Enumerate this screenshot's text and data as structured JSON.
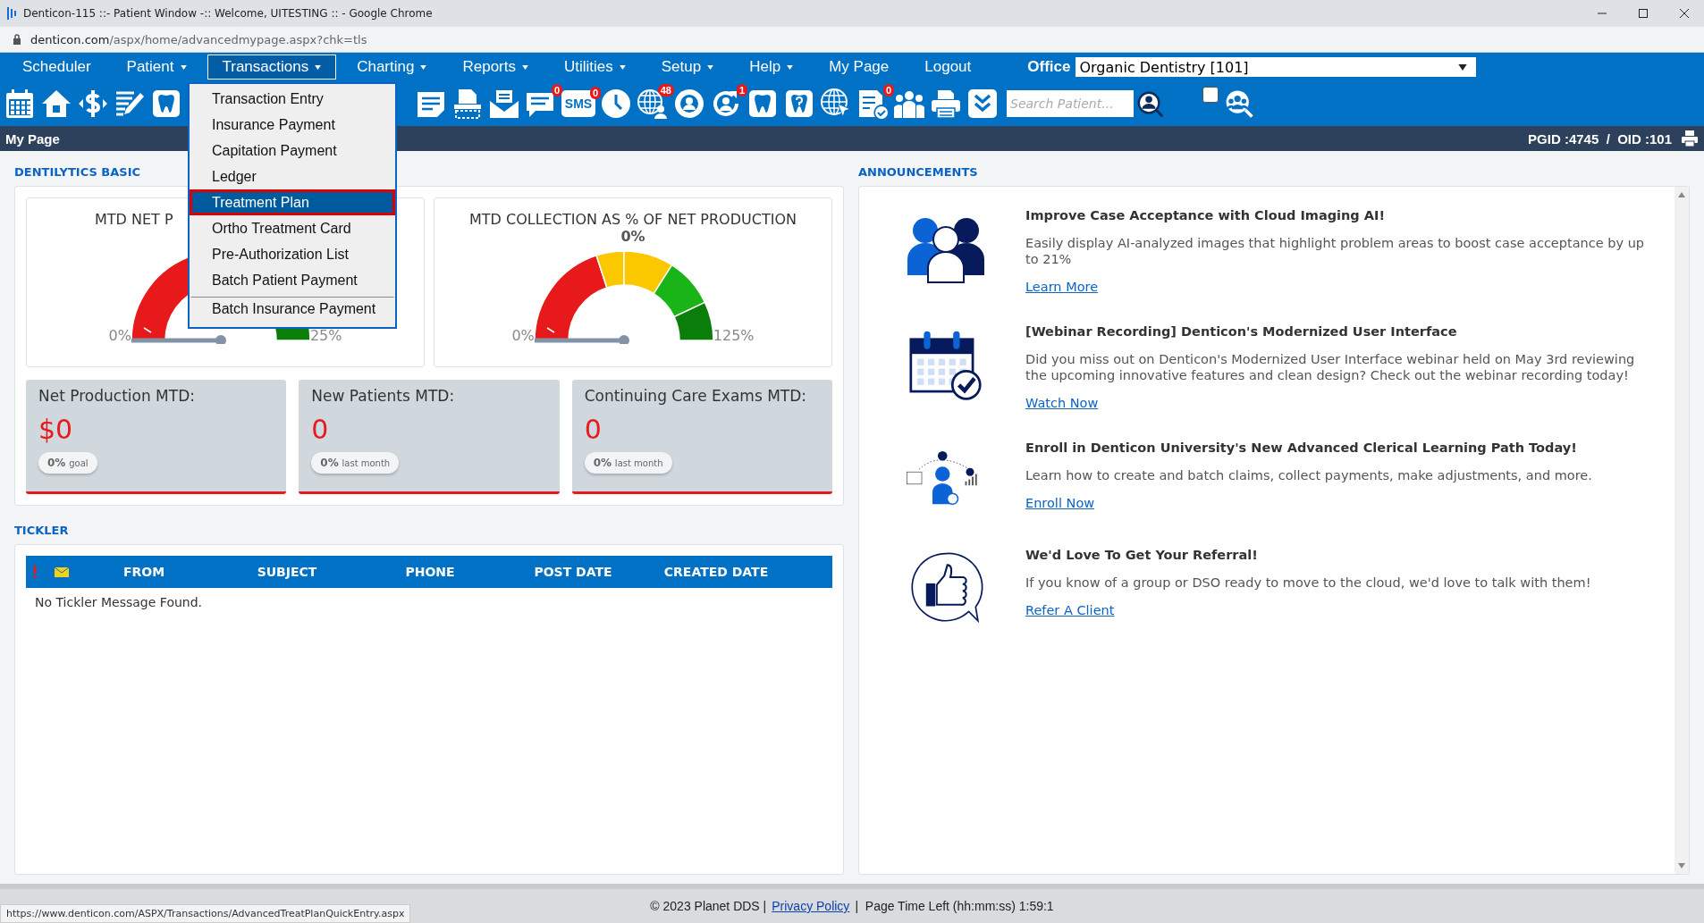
{
  "browser": {
    "title": "Denticon-115 ::- Patient Window -:: Welcome, UITESTING :: - Google Chrome",
    "url_domain": "denticon.com",
    "url_path": "/aspx/home/advancedmypage.aspx?chk=tls"
  },
  "menu": [
    {
      "label": "Scheduler",
      "dropdown": false,
      "selected": false
    },
    {
      "label": "Patient",
      "dropdown": true,
      "selected": false
    },
    {
      "label": "Transactions",
      "dropdown": true,
      "selected": true
    },
    {
      "label": "Charting",
      "dropdown": true,
      "selected": false
    },
    {
      "label": "Reports",
      "dropdown": true,
      "selected": false
    },
    {
      "label": "Utilities",
      "dropdown": true,
      "selected": false
    },
    {
      "label": "Setup",
      "dropdown": true,
      "selected": false
    },
    {
      "label": "Help",
      "dropdown": true,
      "selected": false
    },
    {
      "label": "My Page",
      "dropdown": false,
      "selected": false
    },
    {
      "label": "Logout",
      "dropdown": false,
      "selected": false
    }
  ],
  "office": {
    "label": "Office",
    "value": "Organic Dentistry [101]"
  },
  "dropdown_items": [
    {
      "label": "Transaction Entry",
      "selected": false,
      "separator_before": false
    },
    {
      "label": "Insurance Payment",
      "selected": false,
      "separator_before": false
    },
    {
      "label": "Capitation Payment",
      "selected": false,
      "separator_before": false
    },
    {
      "label": "Ledger",
      "selected": false,
      "separator_before": false
    },
    {
      "label": "Treatment Plan",
      "selected": true,
      "separator_before": false
    },
    {
      "label": "Ortho Treatment Card",
      "selected": false,
      "separator_before": false
    },
    {
      "label": "Pre-Authorization List",
      "selected": false,
      "separator_before": false
    },
    {
      "label": "Batch Patient Payment",
      "selected": false,
      "separator_before": false
    },
    {
      "label": "Batch Insurance Payment",
      "selected": false,
      "separator_before": true
    }
  ],
  "toolbar": {
    "badges": [
      "0",
      "0",
      "48",
      "1",
      "0"
    ],
    "sms_label": "SMS",
    "search_placeholder": "Search Patient...",
    "checkbox_checked": false
  },
  "page_bar": {
    "title": "My Page",
    "ids": "PGID :4745  /  OID :101"
  },
  "dentilytics": {
    "heading": "DENTILYTICS BASIC",
    "gauges": [
      {
        "title": "MTD NET P",
        "min_label": "0%",
        "max_label": "25%"
      },
      {
        "title": "MTD COLLECTION AS % OF NET PRODUCTION",
        "value_label": "0%",
        "min_label": "0%",
        "max_label": "125%"
      }
    ],
    "stats": [
      {
        "label": "Net Production MTD:",
        "value": "$0",
        "pill_value": "0%",
        "pill_label": "goal"
      },
      {
        "label": "New Patients MTD:",
        "value": "0",
        "pill_value": "0%",
        "pill_label": "last month"
      },
      {
        "label": "Continuing Care Exams MTD:",
        "value": "0",
        "pill_value": "0%",
        "pill_label": "last month"
      }
    ]
  },
  "tickler": {
    "heading": "TICKLER",
    "columns": [
      "FROM",
      "SUBJECT",
      "PHONE",
      "POST DATE",
      "CREATED DATE"
    ],
    "empty_message": "No Tickler Message Found."
  },
  "announcements": {
    "heading": "ANNOUNCEMENTS",
    "items": [
      {
        "title": "Improve Case Acceptance with Cloud Imaging AI!",
        "body": "Easily display AI-analyzed images that highlight problem areas to boost case acceptance by up to 21%",
        "link": "Learn More"
      },
      {
        "title": "[Webinar Recording] Denticon's Modernized User Interface",
        "body": "Did you miss out on Denticon's Modernized User Interface webinar held on May 3rd reviewing the upcoming innovative features and clean design? Check out the webinar recording today!",
        "link": "Watch Now"
      },
      {
        "title": "Enroll in Denticon University's New Advanced Clerical Learning Path Today!",
        "body": "Learn how to create and batch claims, collect payments, make adjustments, and more.",
        "link": "Enroll Now"
      },
      {
        "title": "We'd Love To Get Your Referral!",
        "body": "If you know of a group or DSO ready to move to the cloud, we'd love to talk with them!",
        "link": "Refer A Client"
      }
    ]
  },
  "footer": {
    "copyright": "© 2023 Planet DDS |",
    "link": "Privacy Policy",
    "time_left": "|  Page Time Left (hh:mm:ss) 1:59:1"
  },
  "status_url": "https://www.denticon.com/ASPX/Transactions/AdvancedTreatPlanQuickEntry.aspx"
}
